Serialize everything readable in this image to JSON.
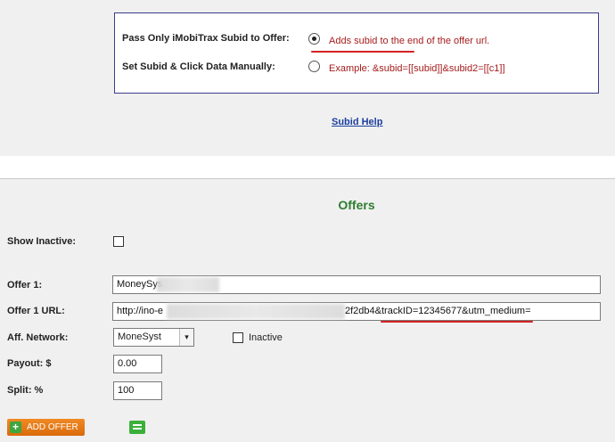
{
  "subid_options": {
    "pass_only": {
      "label": "Pass Only iMobiTrax Subid to Offer:",
      "description": "Adds subid to the end of the offer url.",
      "selected": true
    },
    "manual": {
      "label": "Set Subid & Click Data Manually:",
      "description": "Example: &subid=[[subid]]&subid2=[[c1]]",
      "selected": false
    }
  },
  "help_link": "Subid Help",
  "offers_section": {
    "title": "Offers",
    "show_inactive_label": "Show Inactive:",
    "show_inactive_checked": false,
    "offer_label": "Offer 1:",
    "offer_value": "MoneySys",
    "offer_url_label": "Offer 1 URL:",
    "offer_url_start": "http://ino-e",
    "offer_url_end": "2f2db4&trackID=12345677&utm_medium=",
    "aff_network_label": "Aff. Network:",
    "aff_network_value": "MoneSyst",
    "inactive_label": "Inactive",
    "inactive_checked": false,
    "payout_label": "Payout: $",
    "payout_value": "0.00",
    "split_label": "Split: %",
    "split_value": "100",
    "add_offer_label": "ADD OFFER"
  },
  "colors": {
    "annotation_red": "#d42222",
    "link_blue": "#1b3f9f",
    "title_green": "#2e7d32",
    "button_orange": "#e67816",
    "box_border": "#3c3c8c"
  }
}
